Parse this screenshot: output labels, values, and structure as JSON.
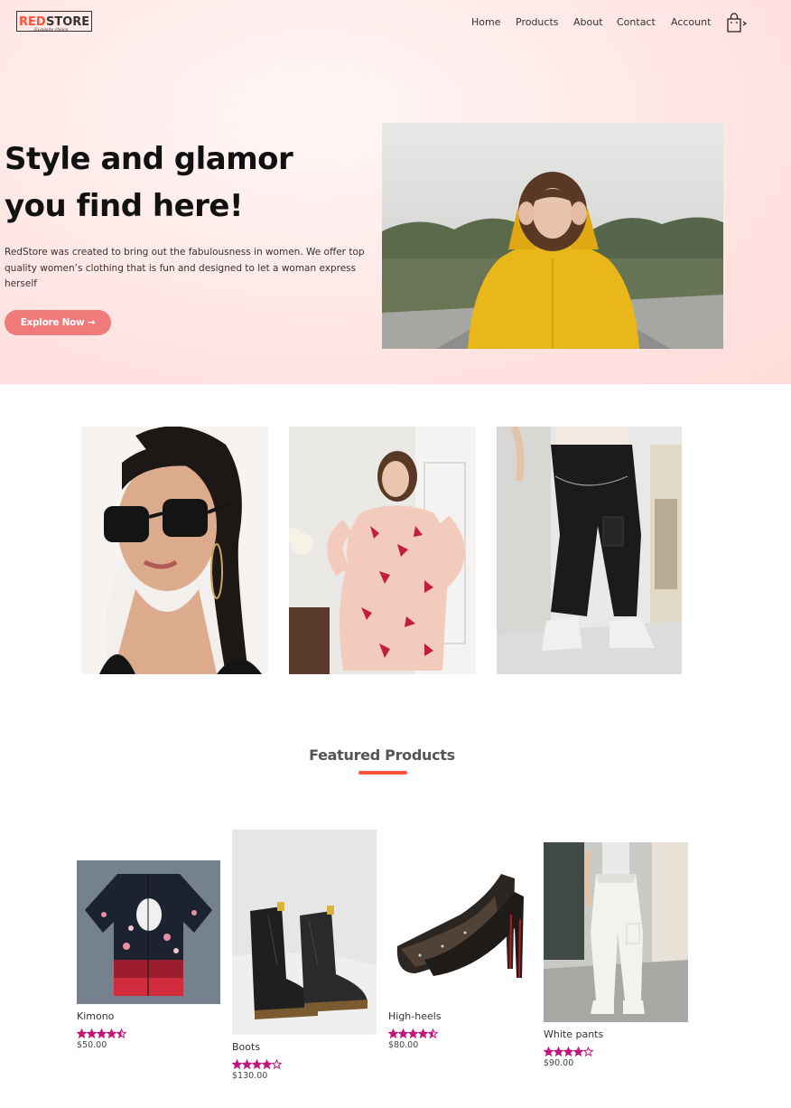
{
  "brand": {
    "name_red": "RED",
    "name_dark": "STORE",
    "tagline": "Exquisite choice",
    "accent_color": "#ff523b"
  },
  "nav": {
    "items": [
      {
        "label": "Home"
      },
      {
        "label": "Products"
      },
      {
        "label": "About"
      },
      {
        "label": "Contact"
      },
      {
        "label": "Account"
      }
    ],
    "cart_icon": "shopping-bag-icon"
  },
  "hero": {
    "title_line1": "Style and glamor",
    "title_line2": "you find here!",
    "description": "RedStore was created to bring out the fabulousness in women. We offer top quality women’s clothing that is fun and designed to let a woman express herself",
    "cta_label": "Explore Now →",
    "cta_color": "#f0797a",
    "image": "woman-in-yellow-jacket-photo"
  },
  "categories": [
    {
      "image": "woman-with-sunglasses-photo"
    },
    {
      "image": "woman-in-floral-dress-photo"
    },
    {
      "image": "woman-in-cargo-pants-photo"
    }
  ],
  "featured": {
    "title": "Featured Products",
    "products": [
      {
        "name": "Kimono",
        "price": "$50.00",
        "rating": 4.5,
        "image": "kimono-photo"
      },
      {
        "name": "Boots",
        "price": "$130.00",
        "rating": 4,
        "image": "boots-photo"
      },
      {
        "name": "High-heels",
        "price": "$80.00",
        "rating": 4.5,
        "image": "high-heels-photo"
      },
      {
        "name": "White pants",
        "price": "$90.00",
        "rating": 4,
        "image": "white-pants-photo"
      }
    ],
    "star_color": "#c4157c"
  }
}
